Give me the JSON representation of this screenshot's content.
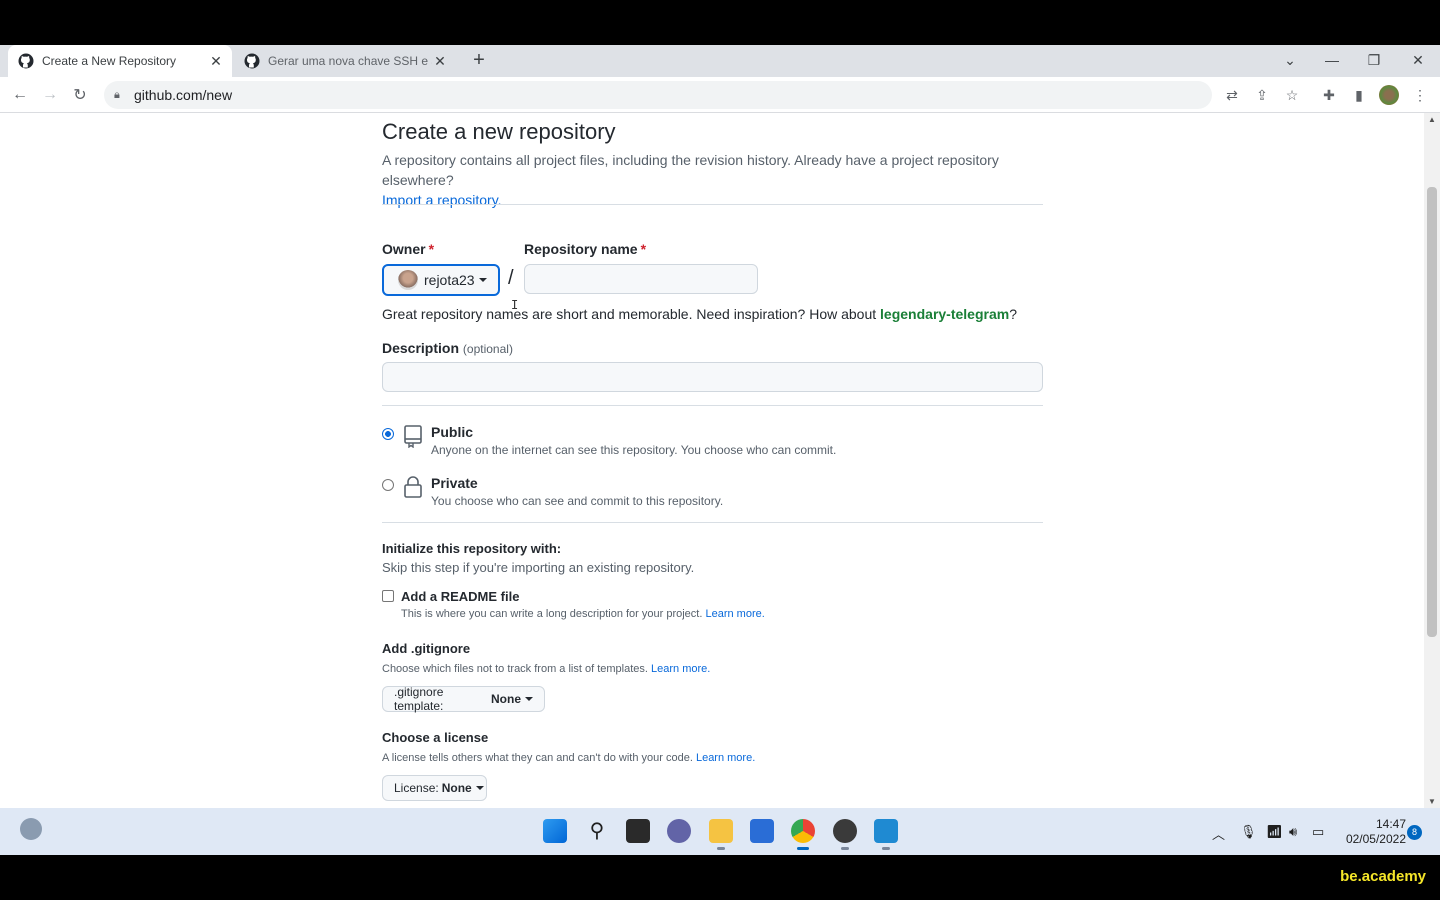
{
  "browser": {
    "tabs": [
      {
        "title": "Create a New Repository",
        "active": true
      },
      {
        "title": "Gerar uma nova chave SSH e adi",
        "active": false
      }
    ],
    "url": "github.com/new"
  },
  "page": {
    "title": "Create a new repository",
    "lead": "A repository contains all project files, including the revision history. Already have a project repository elsewhere?",
    "import_link": "Import a repository.",
    "owner_label": "Owner",
    "required_mark": "*",
    "owner_value": "rejota23",
    "slash": "/",
    "repo_label": "Repository name",
    "repo_value": "",
    "name_hint_pre": "Great repository names are short and memorable. Need inspiration? How about",
    "name_suggestion": "legendary-telegram",
    "name_hint_post": "?",
    "desc_label": "Description",
    "desc_optional": "(optional)",
    "desc_value": "",
    "visibility": {
      "public_title": "Public",
      "public_desc": "Anyone on the internet can see this repository. You choose who can commit.",
      "private_title": "Private",
      "private_desc": "You choose who can see and commit to this repository.",
      "selected": "public"
    },
    "init_title": "Initialize this repository with:",
    "init_sub": "Skip this step if you're importing an existing repository.",
    "readme_label": "Add a README file",
    "readme_desc": "This is where you can write a long description for your project.",
    "learn_more": "Learn more.",
    "gitignore_title": "Add .gitignore",
    "gitignore_desc": "Choose which files not to track from a list of templates.",
    "gitignore_btn_label": ".gitignore template:",
    "gitignore_btn_value": "None",
    "license_title": "Choose a license",
    "license_desc": "A license tells others what they can and can't do with your code.",
    "license_btn_label": "License:",
    "license_btn_value": "None"
  },
  "taskbar": {
    "time": "14:47",
    "date": "02/05/2022",
    "notifications": "8"
  },
  "watermark": "be.academy"
}
